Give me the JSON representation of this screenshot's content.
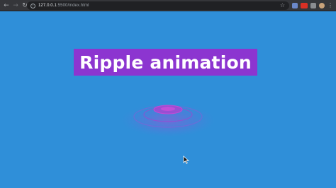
{
  "browser": {
    "url_host": "127.0.0.1",
    "url_path": ":5500/index.html",
    "icons": {
      "back": "arrow-left-icon",
      "forward": "arrow-right-icon",
      "reload": "reload-icon",
      "info": "info-icon",
      "bookmark": "star-icon",
      "menu": "kebab-menu-icon"
    }
  },
  "page": {
    "title": "Ripple animation",
    "background_color": "#2f8fd9",
    "title_background": "#8c35d0"
  }
}
